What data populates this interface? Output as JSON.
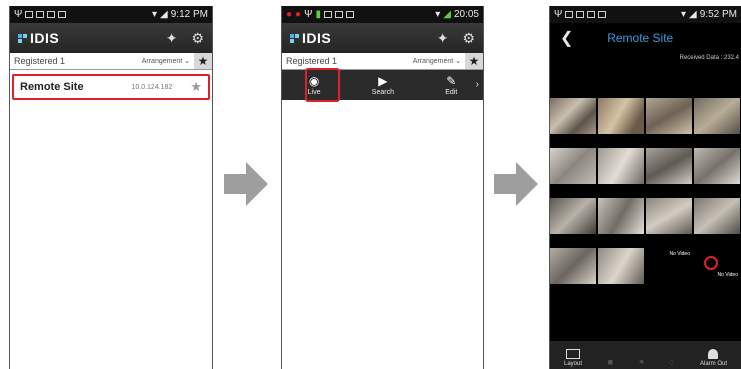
{
  "colors": {
    "highlight": "#e0202a",
    "title_blue": "#3a9dd8",
    "arrow": "#9e9e9e"
  },
  "screen1": {
    "status_time": "9:12 PM",
    "app_title": "IDIS",
    "group_label": "Registered 1",
    "arrangement_label": "Arrangement",
    "site": {
      "name": "Remote Site",
      "ip": "10.0.124.182"
    }
  },
  "screen2": {
    "status_time": "20:05",
    "app_title": "IDIS",
    "group_label": "Registered 1",
    "arrangement_label": "Arrangement",
    "actions": [
      {
        "label": "Live",
        "icon": "eye-icon"
      },
      {
        "label": "Search",
        "icon": "play-circle-icon"
      },
      {
        "label": "Edit",
        "icon": "pencil-icon"
      }
    ]
  },
  "screen3": {
    "status_time": "9:52 PM",
    "title": "Remote Site",
    "received": "Received Data : 232.4",
    "no_video_labels": [
      "No Video",
      "No Video"
    ],
    "bottom": {
      "layout_label": "Layout",
      "alarm_label": "Alarm Out"
    }
  }
}
